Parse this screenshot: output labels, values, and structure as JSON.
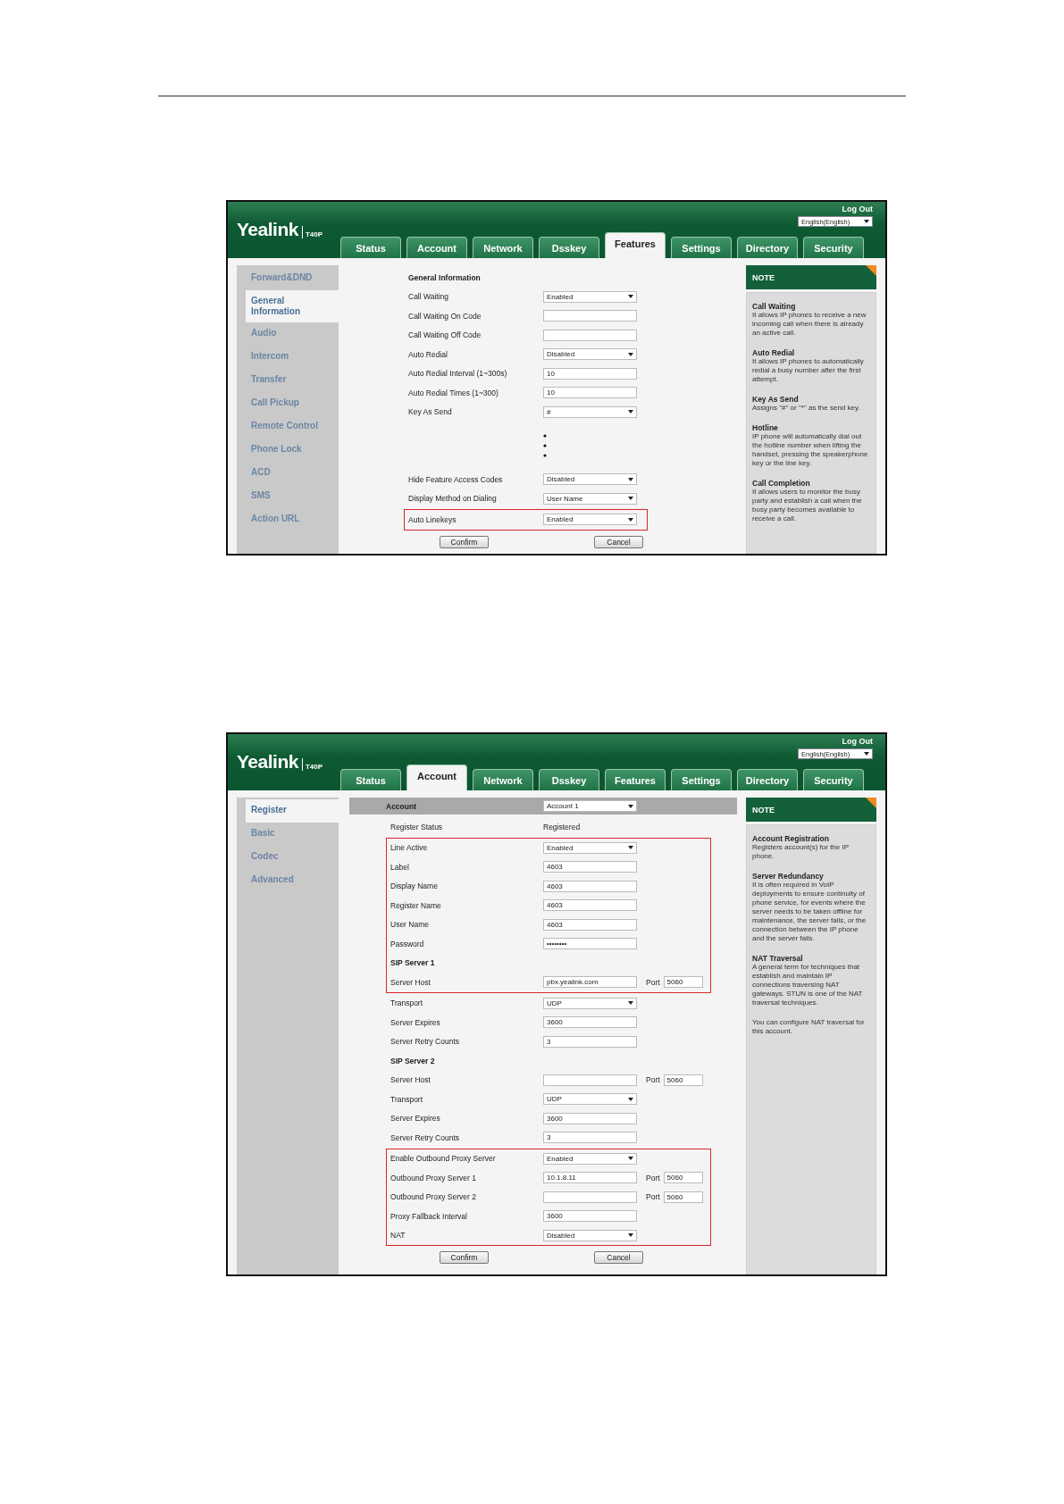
{
  "screenshots": [
    {
      "logout": "Log Out",
      "language": "English(English)",
      "logo": "Yealink",
      "model": "T40P",
      "tabs": [
        {
          "label": "Status",
          "selected": false
        },
        {
          "label": "Account",
          "selected": false
        },
        {
          "label": "Network",
          "selected": false
        },
        {
          "label": "Dsskey",
          "selected": false
        },
        {
          "label": "Features",
          "selected": true
        },
        {
          "label": "Settings",
          "selected": false
        },
        {
          "label": "Directory",
          "selected": false
        },
        {
          "label": "Security",
          "selected": false
        }
      ],
      "sidebar": [
        {
          "label": "Forward&DND",
          "selected": false
        },
        {
          "label": "General Information",
          "selected": true
        },
        {
          "label": "Audio",
          "selected": false
        },
        {
          "label": "Intercom",
          "selected": false
        },
        {
          "label": "Transfer",
          "selected": false
        },
        {
          "label": "Call Pickup",
          "selected": false
        },
        {
          "label": "Remote Control",
          "selected": false
        },
        {
          "label": "Phone Lock",
          "selected": false
        },
        {
          "label": "ACD",
          "selected": false
        },
        {
          "label": "SMS",
          "selected": false
        },
        {
          "label": "Action URL",
          "selected": false
        }
      ],
      "groups": [
        {
          "highlighted": false,
          "rows": [
            {
              "kind": "heading",
              "label": "General Information"
            },
            {
              "kind": "select",
              "label": "Call Waiting",
              "value": "Enabled"
            },
            {
              "kind": "text",
              "label": "Call Waiting On Code"
            },
            {
              "kind": "text",
              "label": "Call Waiting Off Code"
            },
            {
              "kind": "select",
              "label": "Auto Redial",
              "value": "Disabled"
            },
            {
              "kind": "text",
              "label": "Auto Redial Interval (1~300s)",
              "value": "10"
            },
            {
              "kind": "text",
              "label": "Auto Redial Times (1~300)",
              "value": "10"
            },
            {
              "kind": "select",
              "label": "Key As Send",
              "value": "#"
            },
            {
              "kind": "ellipsis"
            },
            {
              "kind": "select",
              "label": "Hide Feature Access Codes",
              "value": "Disabled"
            },
            {
              "kind": "select",
              "label": "Display Method on Dialing",
              "value": "User Name"
            }
          ]
        },
        {
          "highlighted": true,
          "rows": [
            {
              "kind": "select",
              "label": "Auto Linekeys",
              "value": "Enabled"
            }
          ]
        }
      ],
      "buttons": [
        "Confirm",
        "Cancel"
      ],
      "note": {
        "title": "NOTE",
        "sections": [
          {
            "heading": "Call Waiting",
            "body": "It allows IP phones to receive a new incoming call when there is already an active call."
          },
          {
            "heading": "Auto Redial",
            "body": "It allows IP phones to automatically redial a busy number after the first attempt."
          },
          {
            "heading": "Key As Send",
            "body": "Assigns \"#\" or \"*\" as the send key."
          },
          {
            "heading": "Hotline",
            "body": "IP phone will automatically dial out the hotline number when lifting the handset, pressing the speakerphone key or the line key."
          },
          {
            "heading": "Call Completion",
            "body": "It allows users to monitor the busy party and establish a call when the busy party becomes available to receive a call."
          }
        ]
      }
    },
    {
      "logout": "Log Out",
      "language": "English(English)",
      "logo": "Yealink",
      "model": "T40P",
      "tabs": [
        {
          "label": "Status",
          "selected": false
        },
        {
          "label": "Account",
          "selected": true
        },
        {
          "label": "Network",
          "selected": false
        },
        {
          "label": "Dsskey",
          "selected": false
        },
        {
          "label": "Features",
          "selected": false
        },
        {
          "label": "Settings",
          "selected": false
        },
        {
          "label": "Directory",
          "selected": false
        },
        {
          "label": "Security",
          "selected": false
        }
      ],
      "sidebar": [
        {
          "label": "Register",
          "selected": true
        },
        {
          "label": "Basic",
          "selected": false
        },
        {
          "label": "Codec",
          "selected": false
        },
        {
          "label": "Advanced",
          "selected": false
        }
      ],
      "form_header": {
        "label": "Account",
        "value": "Account 1"
      },
      "groups": [
        {
          "highlighted": false,
          "rows": [
            {
              "kind": "static",
              "label": "Register Status",
              "value": "Registered"
            }
          ]
        },
        {
          "highlighted": true,
          "rows": [
            {
              "kind": "select",
              "label": "Line Active",
              "value": "Enabled"
            },
            {
              "kind": "text",
              "label": "Label",
              "value": "4603"
            },
            {
              "kind": "text",
              "label": "Display Name",
              "value": "4603"
            },
            {
              "kind": "text",
              "label": "Register Name",
              "value": "4603"
            },
            {
              "kind": "text",
              "label": "User Name",
              "value": "4603"
            },
            {
              "kind": "password",
              "label": "Password",
              "value": "••••••••"
            },
            {
              "kind": "heading",
              "label": "SIP Server 1"
            },
            {
              "kind": "host",
              "label": "Server Host",
              "value": "pbx.yealink.com",
              "port_label": "Port",
              "port": "5060"
            }
          ]
        },
        {
          "highlighted": false,
          "rows": [
            {
              "kind": "select",
              "label": "Transport",
              "value": "UDP"
            },
            {
              "kind": "text",
              "label": "Server Expires",
              "value": "3600"
            },
            {
              "kind": "text",
              "label": "Server Retry Counts",
              "value": "3"
            },
            {
              "kind": "heading",
              "label": "SIP Server 2"
            },
            {
              "kind": "host",
              "label": "Server Host",
              "port_label": "Port",
              "port": "5060"
            },
            {
              "kind": "select",
              "label": "Transport",
              "value": "UDP"
            },
            {
              "kind": "text",
              "label": "Server Expires",
              "value": "3600"
            },
            {
              "kind": "text",
              "label": "Server Retry Counts",
              "value": "3"
            }
          ]
        },
        {
          "highlighted": true,
          "rows": [
            {
              "kind": "select",
              "label": "Enable Outbound Proxy Server",
              "value": "Enabled"
            },
            {
              "kind": "host",
              "label": "Outbound Proxy Server 1",
              "value": "10.1.8.11",
              "port_label": "Port",
              "port": "5060"
            },
            {
              "kind": "host",
              "label": "Outbound Proxy Server 2",
              "port_label": "Port",
              "port": "5060"
            },
            {
              "kind": "text",
              "label": "Proxy Fallback Interval",
              "value": "3600"
            },
            {
              "kind": "select",
              "label": "NAT",
              "value": "Disabled"
            }
          ]
        }
      ],
      "buttons": [
        "Confirm",
        "Cancel"
      ],
      "note": {
        "title": "NOTE",
        "sections": [
          {
            "heading": "Account Registration",
            "body": "Registers account(s) for the IP phone."
          },
          {
            "heading": "Server Redundancy",
            "body": "It is often required in VoIP deployments to ensure continuity of phone service, for events where the server needs to be taken offline for maintenance, the server fails, or the connection between the IP phone and the server fails."
          },
          {
            "heading": "NAT Traversal",
            "body": "A general term for techniques that establish and maintain IP connections traversing NAT gateways. STUN is one of the NAT traversal techniques."
          },
          {
            "body": "You can configure NAT traversal for this account."
          }
        ]
      }
    }
  ]
}
